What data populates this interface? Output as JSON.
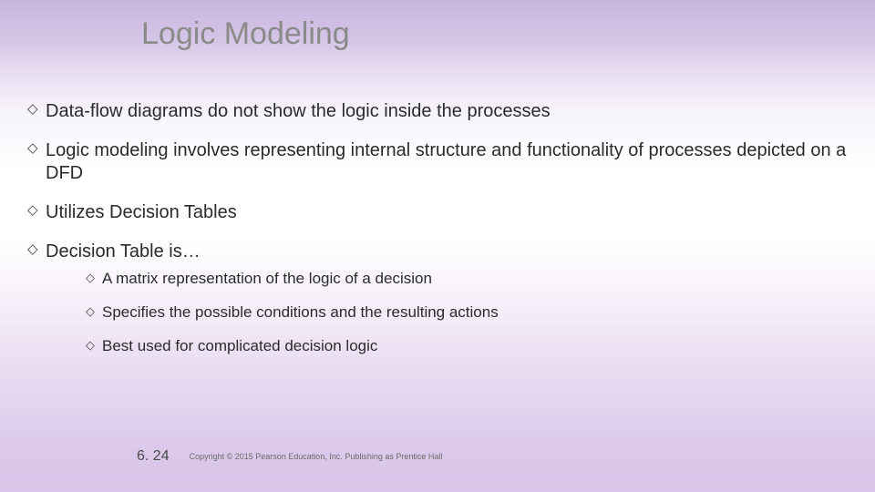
{
  "title": "Logic Modeling",
  "bullets": [
    {
      "text": "Data-flow diagrams do not show the logic inside the processes"
    },
    {
      "text": "Logic modeling involves representing internal structure and functionality of processes depicted on a DFD"
    },
    {
      "text": "Utilizes Decision Tables"
    },
    {
      "text": "Decision Table is…",
      "sub": [
        "A matrix representation of the logic of a decision",
        "Specifies the possible conditions and the resulting actions",
        "Best used for complicated decision logic"
      ]
    }
  ],
  "footer": {
    "page": "6. 24",
    "copyright": "Copyright © 2015 Pearson Education, Inc. Publishing as Prentice Hall"
  }
}
